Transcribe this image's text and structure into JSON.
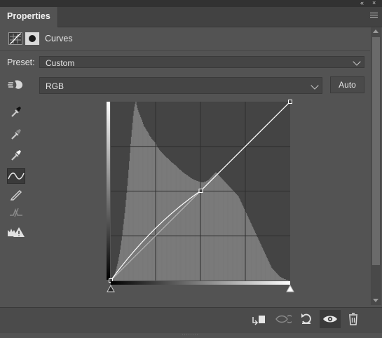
{
  "panel": {
    "tab_title": "Properties",
    "header_label": "Curves",
    "collapse_glyph": "«",
    "close_glyph": "×"
  },
  "preset": {
    "label": "Preset:",
    "value": "Custom"
  },
  "channel": {
    "value": "RGB",
    "auto_label": "Auto"
  },
  "tools": [
    {
      "name": "on-image-adjust-icon"
    },
    {
      "name": "black-point-eyedropper-icon"
    },
    {
      "name": "gray-point-eyedropper-icon"
    },
    {
      "name": "white-point-eyedropper-icon"
    },
    {
      "name": "curve-points-icon",
      "active": true
    },
    {
      "name": "pencil-icon"
    },
    {
      "name": "smooth-curve-icon"
    },
    {
      "name": "clipping-warning-icon"
    }
  ],
  "curve": {
    "points": [
      [
        0,
        0
      ],
      [
        128,
        128
      ],
      [
        255,
        255
      ]
    ],
    "histogram": [
      2,
      3,
      4,
      5,
      6,
      8,
      10,
      13,
      16,
      20,
      24,
      28,
      33,
      38,
      44,
      50,
      57,
      64,
      72,
      80,
      88,
      96,
      105,
      115,
      125,
      135,
      146,
      158,
      170,
      182,
      195,
      205,
      215,
      225,
      235,
      242,
      248,
      252,
      255,
      250,
      246,
      243,
      240,
      238,
      236,
      233,
      231,
      229,
      226,
      223,
      220,
      219,
      218,
      216,
      214,
      213,
      212,
      210,
      208,
      206,
      205,
      204,
      202,
      201,
      200,
      199,
      198,
      197,
      196,
      194,
      192,
      190,
      189,
      188,
      186,
      185,
      184,
      183,
      182,
      181,
      180,
      179,
      178,
      177,
      176,
      175,
      175,
      174,
      173,
      172,
      171,
      170,
      169,
      168,
      168,
      167,
      166,
      165,
      165,
      164,
      163,
      162,
      161,
      160,
      159,
      158,
      158,
      157,
      156,
      155,
      154,
      154,
      153,
      152,
      152,
      151,
      150,
      150,
      149,
      148,
      148,
      147,
      146,
      146,
      145,
      145,
      144,
      144,
      143,
      143,
      143,
      142,
      142,
      142,
      141,
      141,
      141,
      141,
      140,
      140,
      140,
      140,
      140,
      141,
      141,
      141,
      142,
      142,
      143,
      143,
      144,
      145,
      146,
      147,
      148,
      149,
      150,
      151,
      152,
      153,
      154,
      154,
      153,
      152,
      151,
      150,
      149,
      148,
      147,
      146,
      145,
      144,
      143,
      142,
      141,
      140,
      139,
      138,
      137,
      136,
      135,
      134,
      133,
      132,
      131,
      130,
      129,
      128,
      127,
      126,
      125,
      124,
      123,
      122,
      121,
      120,
      118,
      116,
      114,
      112,
      110,
      108,
      106,
      104,
      102,
      100,
      98,
      96,
      94,
      92,
      90,
      88,
      86,
      84,
      82,
      80,
      78,
      76,
      74,
      72,
      70,
      68,
      66,
      64,
      62,
      60,
      58,
      56,
      54,
      52,
      50,
      48,
      46,
      44,
      42,
      40,
      38,
      36,
      34,
      32,
      30,
      28,
      26,
      24,
      22,
      20,
      18,
      17,
      16,
      15,
      14,
      13,
      12,
      11,
      10,
      9,
      8,
      7,
      6,
      5,
      5,
      4,
      4,
      3,
      3,
      2,
      2,
      2,
      1,
      1,
      1,
      1,
      0,
      0,
      0
    ]
  },
  "bottom_toolbar": [
    {
      "name": "clip-to-layer-icon"
    },
    {
      "name": "view-previous-state-icon"
    },
    {
      "name": "reset-adjustment-icon"
    },
    {
      "name": "toggle-visibility-icon",
      "active": true
    },
    {
      "name": "delete-adjustment-icon"
    }
  ]
}
